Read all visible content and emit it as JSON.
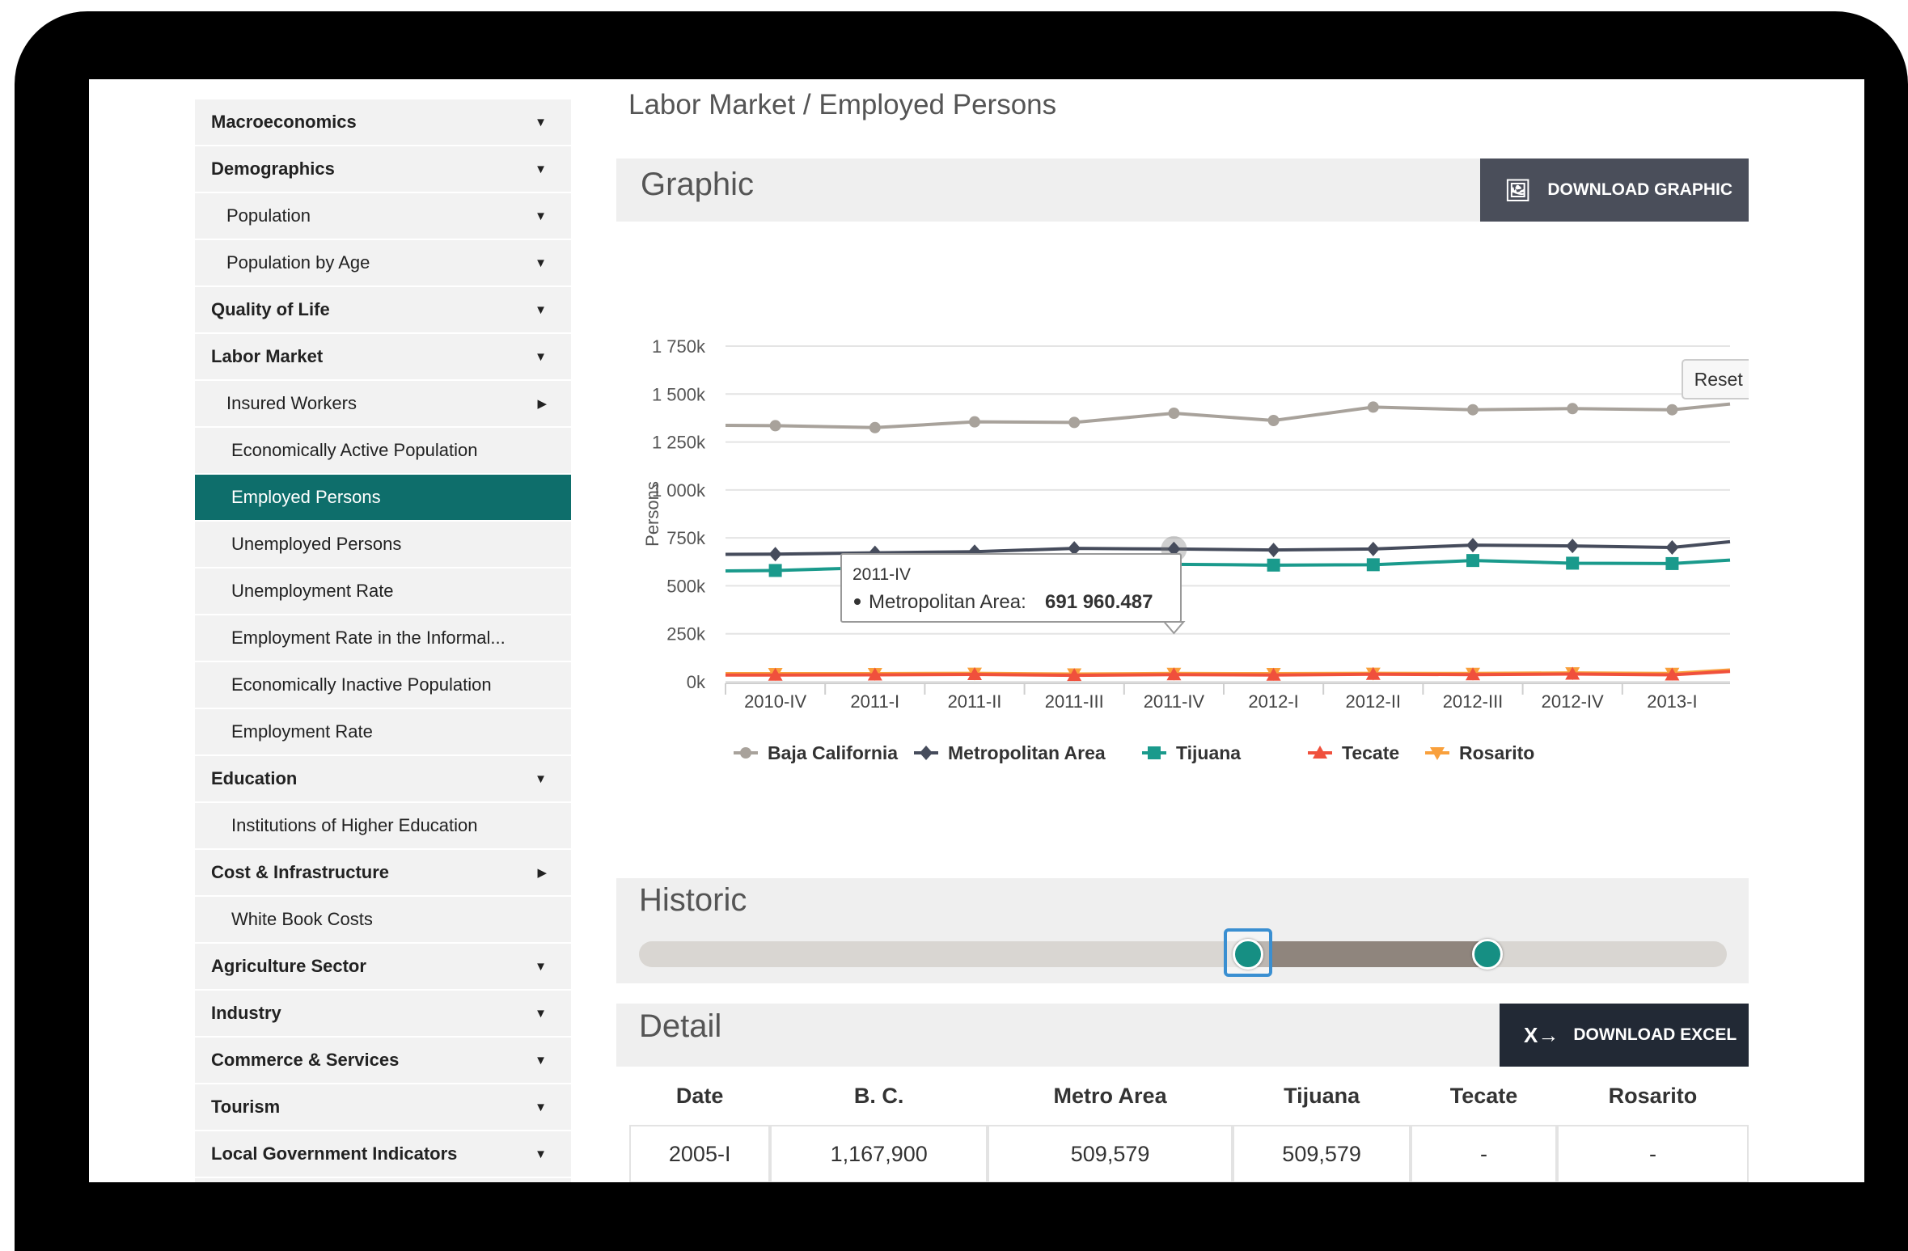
{
  "sidebar": {
    "items": [
      {
        "label": "Macroeconomics",
        "level": 0,
        "arrow": "▼"
      },
      {
        "label": "Demographics",
        "level": 0,
        "arrow": "▼"
      },
      {
        "label": "Population",
        "level": 1,
        "arrow": "▼"
      },
      {
        "label": "Population by Age",
        "level": 1,
        "arrow": "▼"
      },
      {
        "label": "Quality of Life",
        "level": 0,
        "arrow": "▼"
      },
      {
        "label": "Labor Market",
        "level": 0,
        "arrow": "▼"
      },
      {
        "label": "Insured Workers",
        "level": 1,
        "arrow": "▶"
      },
      {
        "label": "Economically Active Population",
        "level": 2,
        "arrow": ""
      },
      {
        "label": "Employed Persons",
        "level": 2,
        "arrow": "",
        "active": true
      },
      {
        "label": "Unemployed Persons",
        "level": 2,
        "arrow": ""
      },
      {
        "label": "Unemployment Rate",
        "level": 2,
        "arrow": ""
      },
      {
        "label": "Employment Rate in the Informal...",
        "level": 2,
        "arrow": ""
      },
      {
        "label": "Economically Inactive Population",
        "level": 2,
        "arrow": ""
      },
      {
        "label": "Employment Rate",
        "level": 2,
        "arrow": ""
      },
      {
        "label": "Education",
        "level": 0,
        "arrow": "▼"
      },
      {
        "label": "Institutions of Higher Education",
        "level": 2,
        "arrow": ""
      },
      {
        "label": "Cost & Infrastructure",
        "level": 0,
        "arrow": "▶"
      },
      {
        "label": "White Book Costs",
        "level": 2,
        "arrow": ""
      },
      {
        "label": "Agriculture Sector",
        "level": 0,
        "arrow": "▼"
      },
      {
        "label": "Industry",
        "level": 0,
        "arrow": "▼"
      },
      {
        "label": "Commerce & Services",
        "level": 0,
        "arrow": "▼"
      },
      {
        "label": "Tourism",
        "level": 0,
        "arrow": "▼"
      },
      {
        "label": "Local Government Indicators",
        "level": 0,
        "arrow": "▼"
      }
    ]
  },
  "breadcrumb": "Labor Market / Employed Persons",
  "graphic": {
    "title": "Graphic",
    "download_label": "DOWNLOAD GRAPHIC",
    "reset_zoom": "Reset zoom"
  },
  "tooltip": {
    "period": "2011-IV",
    "series": "Metropolitan Area:",
    "value": "691 960.487"
  },
  "historic": {
    "title": "Historic",
    "range_start": 0.56,
    "range_end": 0.78
  },
  "detail": {
    "title": "Detail",
    "download_label": "DOWNLOAD EXCEL",
    "columns": [
      "Date",
      "B. C.",
      "Metro Area",
      "Tijuana",
      "Tecate",
      "Rosarito"
    ],
    "rows": [
      [
        "2005-I",
        "1,167,900",
        "509,579",
        "509,579",
        "-",
        "-"
      ]
    ]
  },
  "colors": {
    "accent": "#0e6e6b",
    "baja": "#a8a29b",
    "metro": "#464c5c",
    "tijuana": "#1a9a8c",
    "tecate": "#f0503c",
    "rosarito": "#f9a03c"
  },
  "chart_data": {
    "type": "line",
    "ylabel": "Persons",
    "ylim": [
      0,
      1750000
    ],
    "yticks": [
      "0k",
      "250k",
      "500k",
      "750k",
      "1 000k",
      "1 250k",
      "1 500k",
      "1 750k"
    ],
    "categories": [
      "2010-IV",
      "2011-I",
      "2011-II",
      "2011-III",
      "2011-IV",
      "2012-I",
      "2012-II",
      "2012-III",
      "2012-IV",
      "2013-I"
    ],
    "series": [
      {
        "name": "Baja California",
        "marker": "circle",
        "values": [
          1335000,
          1325000,
          1355000,
          1352000,
          1400000,
          1362000,
          1432000,
          1418000,
          1424000,
          1418000
        ]
      },
      {
        "name": "Metropolitan Area",
        "marker": "diamond",
        "values": [
          665000,
          672000,
          678000,
          695000,
          691960,
          687000,
          692000,
          712000,
          708000,
          700000
        ]
      },
      {
        "name": "Tijuana",
        "marker": "square",
        "values": [
          580000,
          595000,
          595000,
          625000,
          612000,
          608000,
          610000,
          632000,
          618000,
          616000
        ]
      },
      {
        "name": "Tecate",
        "marker": "triangle",
        "values": [
          35000,
          36000,
          38000,
          33000,
          37000,
          35000,
          39000,
          37000,
          40000,
          36000
        ]
      },
      {
        "name": "Rosarito",
        "marker": "triangle-down",
        "values": [
          42000,
          42000,
          44000,
          40000,
          43000,
          42000,
          44000,
          43000,
          46000,
          43000
        ]
      }
    ]
  }
}
